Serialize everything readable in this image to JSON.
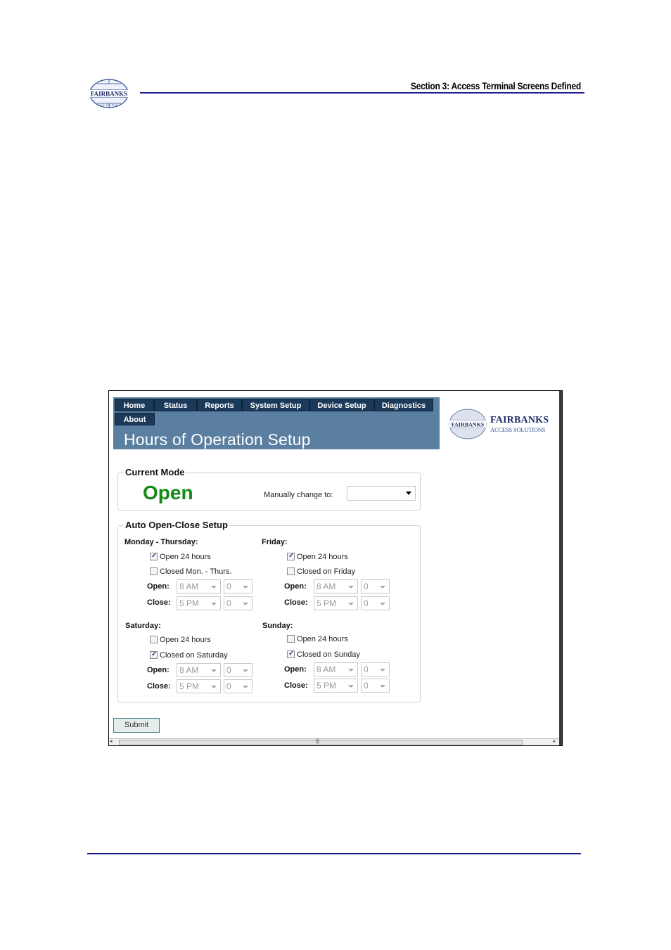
{
  "document": {
    "header_title": "Section 3:  Access Terminal Screens Defined",
    "logo_text": "FAIRBANKS",
    "logo_subtext": "SCALES"
  },
  "screenshot": {
    "nav": {
      "items": [
        {
          "label": "Home"
        },
        {
          "label": "Status"
        },
        {
          "label": "Reports"
        },
        {
          "label": "System Setup"
        },
        {
          "label": "Device Setup"
        },
        {
          "label": "Diagnostics"
        },
        {
          "label": "About"
        }
      ]
    },
    "page_title": "Hours of Operation Setup",
    "brand": {
      "logo_text": "FAIRBANKS",
      "name": "FAIRBANKS",
      "tagline": "ACCESS SOLUTIONS"
    },
    "current_mode": {
      "legend": "Current Mode",
      "value": "Open",
      "manual_label": "Manually change to:",
      "manual_value": ""
    },
    "auto_setup": {
      "legend": "Auto Open-Close Setup",
      "open_label": "Open:",
      "close_label": "Close:",
      "days": {
        "mon_thu": {
          "heading": "Monday - Thursday:",
          "open24": {
            "label": "Open 24 hours",
            "checked": true
          },
          "closed": {
            "label": "Closed Mon. - Thurs.",
            "checked": false
          },
          "open_hour": "8 AM",
          "open_min": "0",
          "close_hour": "5 PM",
          "close_min": "0"
        },
        "friday": {
          "heading": "Friday:",
          "open24": {
            "label": "Open 24 hours",
            "checked": true
          },
          "closed": {
            "label": "Closed on Friday",
            "checked": false
          },
          "open_hour": "8 AM",
          "open_min": "0",
          "close_hour": "5 PM",
          "close_min": "0"
        },
        "saturday": {
          "heading": "Saturday:",
          "open24": {
            "label": "Open 24 hours",
            "checked": false
          },
          "closed": {
            "label": "Closed on Saturday",
            "checked": true
          },
          "open_hour": "8 AM",
          "open_min": "0",
          "close_hour": "5 PM",
          "close_min": "0"
        },
        "sunday": {
          "heading": "Sunday:",
          "open24": {
            "label": "Open 24 hours",
            "checked": false
          },
          "closed": {
            "label": "Closed on Sunday",
            "checked": true
          },
          "open_hour": "8 AM",
          "open_min": "0",
          "close_hour": "5 PM",
          "close_min": "0"
        }
      }
    },
    "submit_label": "Submit",
    "colors": {
      "banner": "#5b7fa0",
      "nav": "#1b3a5a",
      "mode_open": "#148a14",
      "rule": "#1e1f8a"
    }
  }
}
